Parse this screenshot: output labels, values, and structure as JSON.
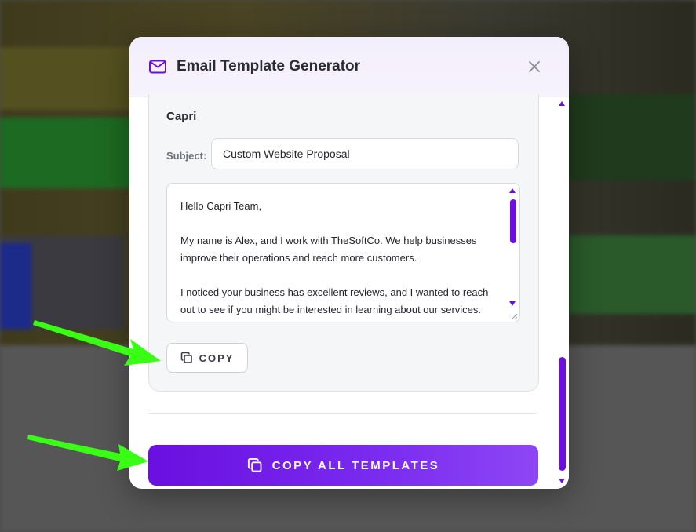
{
  "modal": {
    "title": "Email Template Generator",
    "close_icon": "close-icon",
    "header_icon": "mail-icon"
  },
  "template": {
    "company": "Capri",
    "subject_label": "Subject:",
    "subject_value": "Custom Website Proposal",
    "body": "Hello Capri Team,\n\nMy name is Alex, and I work with TheSoftCo. We help businesses improve their operations and reach more customers.\n\nI noticed your business has excellent reviews, and I wanted to reach out to see if you might be interested in learning about our services.",
    "copy_label": "COPY"
  },
  "footer": {
    "copy_all_label": "COPY ALL TEMPLATES"
  },
  "colors": {
    "accent": "#6a0fe0",
    "annotation_arrow": "#39ff14"
  }
}
